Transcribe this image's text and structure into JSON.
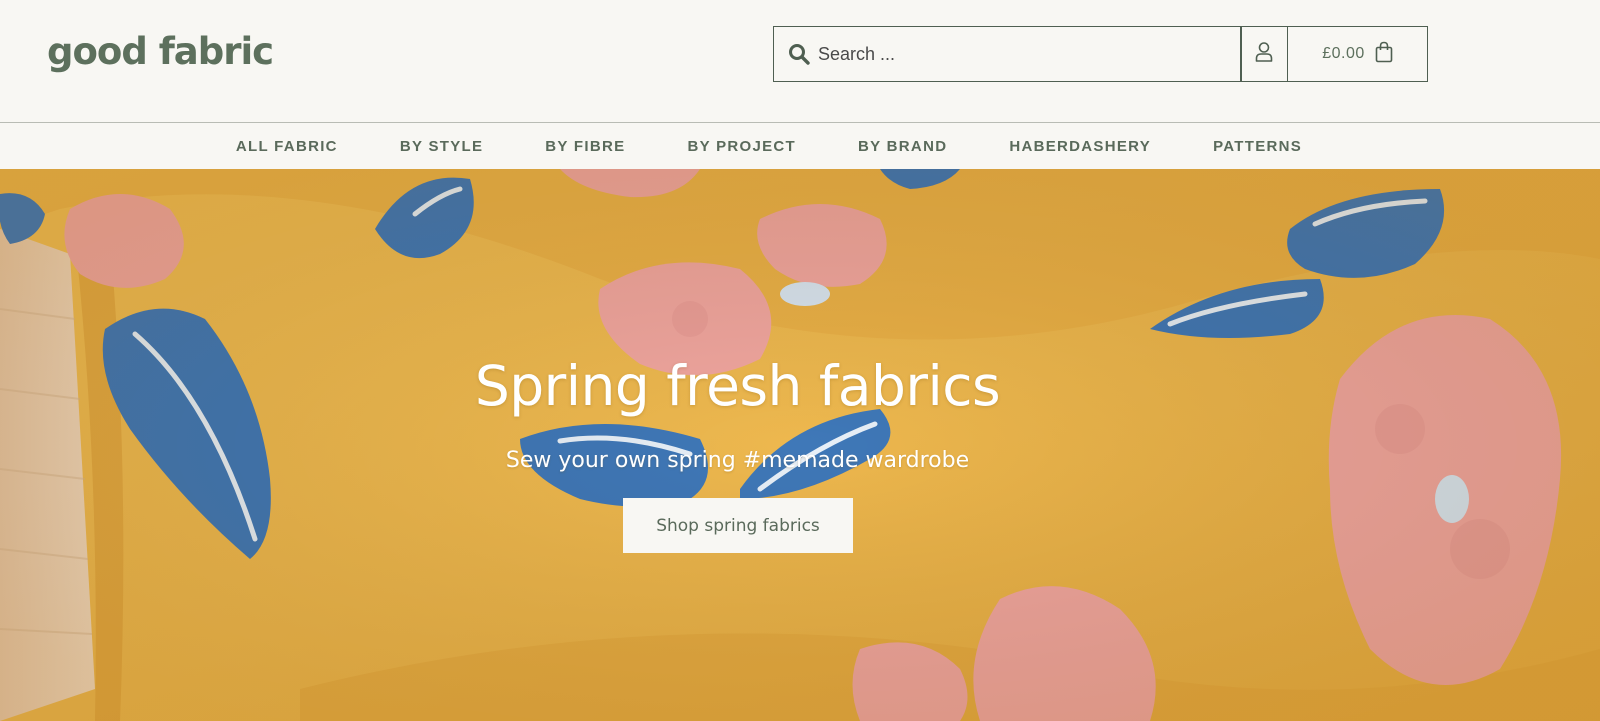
{
  "brand": {
    "logo_text": "good fabric",
    "color": "#5d705d"
  },
  "search": {
    "placeholder": "Search ...",
    "value": "",
    "icon": "search-icon"
  },
  "account": {
    "icon": "user-icon"
  },
  "cart": {
    "total": "£0.00",
    "icon": "shopping-bag-icon"
  },
  "nav": {
    "items": [
      {
        "label": "ALL FABRIC"
      },
      {
        "label": "BY STYLE"
      },
      {
        "label": "BY FIBRE"
      },
      {
        "label": "BY PROJECT"
      },
      {
        "label": "BY BRAND"
      },
      {
        "label": "HABERDASHERY"
      },
      {
        "label": "PATTERNS"
      }
    ]
  },
  "hero": {
    "title": "Spring fresh fabrics",
    "subtitle": "Sew your own spring #memade wardrobe",
    "cta_label": "Shop spring fabrics",
    "colors": {
      "fabric": "#eeb84e",
      "leaf": "#3f78b8",
      "petal": "#f2a7a0"
    }
  }
}
